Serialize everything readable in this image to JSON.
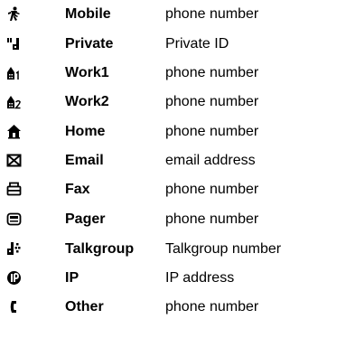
{
  "entries": [
    {
      "icon": "mobile-icon",
      "label": "Mobile",
      "value": "phone number"
    },
    {
      "icon": "private-icon",
      "label": "Private",
      "value": "Private ID"
    },
    {
      "icon": "work1-icon",
      "label": "Work1",
      "value": "phone number"
    },
    {
      "icon": "work2-icon",
      "label": "Work2",
      "value": "phone number"
    },
    {
      "icon": "home-icon",
      "label": "Home",
      "value": "phone number"
    },
    {
      "icon": "email-icon",
      "label": "Email",
      "value": "email address"
    },
    {
      "icon": "fax-icon",
      "label": "Fax",
      "value": "phone number"
    },
    {
      "icon": "pager-icon",
      "label": "Pager",
      "value": "phone number"
    },
    {
      "icon": "talkgroup-icon",
      "label": "Talkgroup",
      "value": "Talkgroup number"
    },
    {
      "icon": "ip-icon",
      "label": "IP",
      "value": "IP address"
    },
    {
      "icon": "other-icon",
      "label": "Other",
      "value": "phone number"
    }
  ]
}
